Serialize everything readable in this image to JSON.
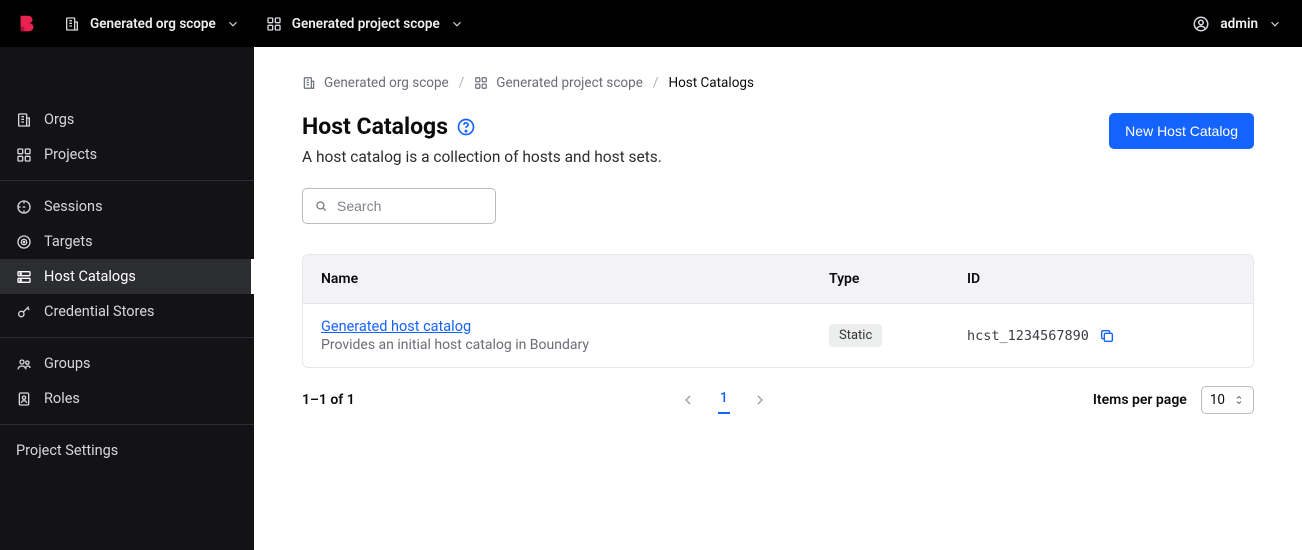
{
  "topbar": {
    "org_scope": "Generated org scope",
    "project_scope": "Generated project scope",
    "user": "admin"
  },
  "sidebar": {
    "orgs": "Orgs",
    "projects": "Projects",
    "sessions": "Sessions",
    "targets": "Targets",
    "host_catalogs": "Host Catalogs",
    "credential_stores": "Credential Stores",
    "groups": "Groups",
    "roles": "Roles",
    "project_settings": "Project Settings"
  },
  "breadcrumbs": {
    "org": "Generated org scope",
    "project": "Generated project scope",
    "current": "Host Catalogs"
  },
  "page": {
    "title": "Host Catalogs",
    "subtitle": "A host catalog is a collection of hosts and host sets.",
    "new_button": "New Host Catalog",
    "search_placeholder": "Search"
  },
  "table": {
    "headers": {
      "name": "Name",
      "type": "Type",
      "id": "ID"
    },
    "rows": [
      {
        "name": "Generated host catalog",
        "description": "Provides an initial host catalog in Boundary",
        "type": "Static",
        "id": "hcst_1234567890"
      }
    ]
  },
  "pagination": {
    "summary": "1–1 of 1",
    "page": "1",
    "items_per_page_label": "Items per page",
    "items_per_page_value": "10"
  }
}
